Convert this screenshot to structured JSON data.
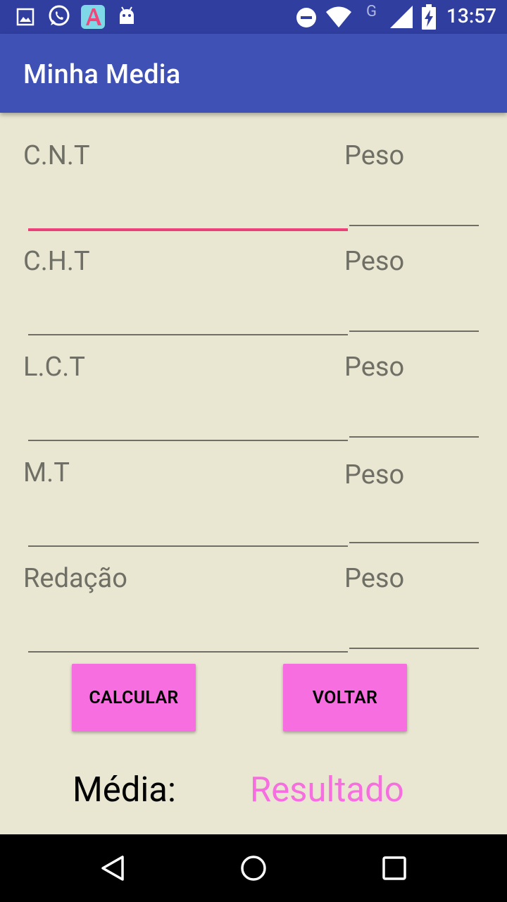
{
  "status_bar": {
    "time": "13:57",
    "network_type": "G",
    "icons": [
      "image-icon",
      "whatsapp-icon",
      "app-a-icon",
      "android-icon",
      "dnd-icon",
      "wifi-icon",
      "signal-icon",
      "battery-charging-icon"
    ]
  },
  "app_bar": {
    "title": "Minha Media"
  },
  "rows": [
    {
      "label": "C.N.T",
      "peso_label": "Peso",
      "value": "",
      "peso_value": ""
    },
    {
      "label": "C.H.T",
      "peso_label": "Peso",
      "value": "",
      "peso_value": ""
    },
    {
      "label": "L.C.T",
      "peso_label": "Peso",
      "value": "",
      "peso_value": ""
    },
    {
      "label": "M.T",
      "peso_label": "Peso",
      "value": "",
      "peso_value": ""
    },
    {
      "label": "Redação",
      "peso_label": "Peso",
      "value": "",
      "peso_value": ""
    }
  ],
  "buttons": {
    "calcular": "CALCULAR",
    "voltar": "VOLTAR"
  },
  "result": {
    "label": "Média:",
    "value": "Resultado"
  },
  "colors": {
    "status_bar": "#303f9f",
    "app_bar": "#3f51b5",
    "background": "#e9e7d1",
    "accent": "#ec407a",
    "button": "#f66ee0",
    "result_text": "#f66ee0"
  },
  "nav_bar": {
    "icons": [
      "back-icon",
      "home-icon",
      "recents-icon"
    ]
  }
}
